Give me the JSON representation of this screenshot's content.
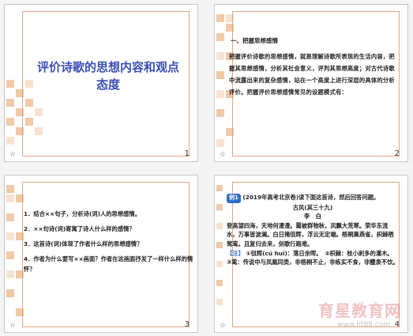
{
  "slides": [
    {
      "number": "1",
      "star": "☆",
      "title": "评价诗歌的思想内容和观点态度"
    },
    {
      "number": "2",
      "star": "☆",
      "heading": "一、把握思想感情",
      "body": "把握评价诗歌的思想感情，就是理解诗歌所表现的生活内容，把握其思想感情，分析其社会意义，评判其思想高度；对古代诗歌中流露出来的复杂感情，站在一个高度上进行深层的具体的分析评价。把握评价思想感情常见的设题模式有："
    },
    {
      "number": "3",
      "star": "☆",
      "items": [
        "1．结合××句子，分析诗(词)人的思想感情。",
        "2．××句诗(词)寄寓了诗人什么样的感情？",
        "3．这首诗(词)体现了作者什么样的思想感情？",
        "4．作者为什么要写××画面？作者在这画面抒发了一样什么样的情怀？"
      ]
    },
    {
      "number": "4",
      "star": "☆",
      "badge": "例1",
      "intro": "(2019年高考北京卷)读下面这首诗，然后回答问题。",
      "poem_title": "古风(其三十九)",
      "author": "李　白",
      "poem": "登高望四海，天地何漫漫。霜被群物秋，风飘大荒寒。荣华东流水，万事皆波澜。白日掩徂辉，浮云无定端。梧桐巢燕雀，枳棘栖鸳鸾。且复归去来，剑歌行路难。",
      "note_tag": "【注】",
      "note": "①徂辉(cú huī)：落日余晖。　②枳棘：枝小刺多的灌木。　③鸾：传说中与凤凰同类，非梧桐不止，非练实不食，非醴泉不饮。",
      "watermark": "育星教育网",
      "watermark_url": "www.ht88.com"
    }
  ],
  "colors": {
    "frame": "#e2a582",
    "title": "#3a4fb4",
    "squares": [
      "#f0c9a8",
      "#f8e2cf"
    ]
  }
}
